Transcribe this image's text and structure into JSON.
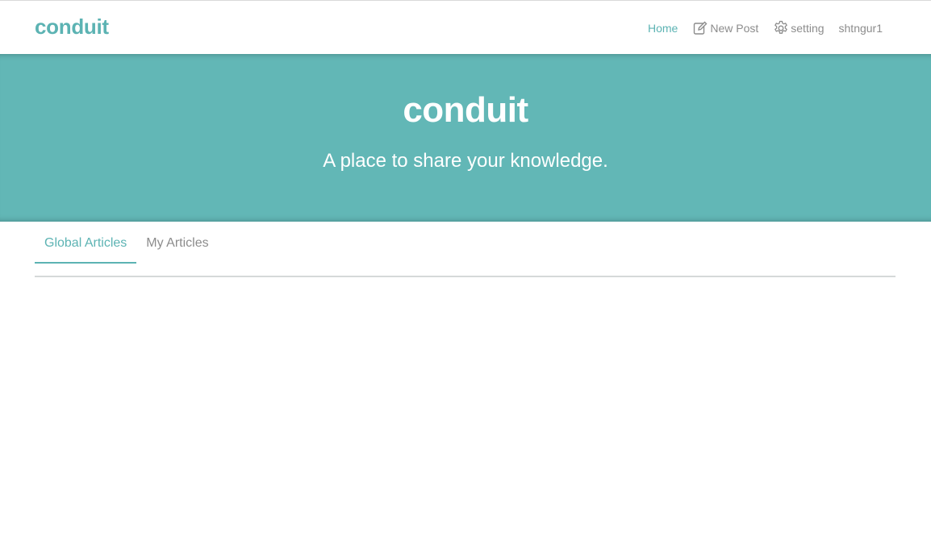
{
  "navbar": {
    "brand": "conduit",
    "links": {
      "home": "Home",
      "new_post": "New Post",
      "settings": "setting",
      "username": "shtngur1"
    },
    "icons": {
      "new_post": "edit-icon",
      "settings": "gear-icon"
    }
  },
  "banner": {
    "title": "conduit",
    "subtitle": "A place to share your knowledge."
  },
  "feed": {
    "tabs": {
      "global": "Global Articles",
      "mine": "My Articles"
    },
    "active_tab": "Global Articles"
  },
  "colors": {
    "brand": "#5cb3b3",
    "banner_bg": "#62b7b6",
    "muted_text": "#8c8c8c",
    "divider": "#d5d9d9"
  }
}
